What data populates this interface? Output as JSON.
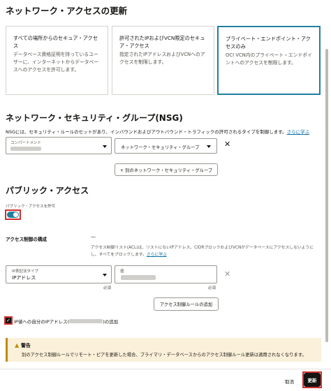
{
  "header": {
    "title": "ネットワーク・アクセスの更新"
  },
  "access_cards": [
    {
      "title": "すべての場所からのセキュア・アクセス",
      "desc": "データベース資格証明を持っているユーザーに、インターネットからデータベースへのアクセスを許可します。"
    },
    {
      "title": "許可されたIPおよびVCN限定のセキュア・アクセス",
      "desc": "指定されたIPアドレスおよびVCNへのアクセスを制限します。"
    },
    {
      "title": "プライベート・エンドポイント・アクセスのみ",
      "desc": "OCI VCN内のプライベート・エンドポイントへのアクセスを制限します。"
    }
  ],
  "nsg": {
    "heading": "ネットワーク・セキュリティ・グループ(NSG)",
    "desc": "NSGには、セキュリティ・ルールのセットがあり、インバウンドおよびアウトバウンド・トラフィックの許可されるタイプを制御します。",
    "learn_more": "さらに学ぶ",
    "compartment_label": "コンパートメント",
    "nsg_select_placeholder": "ネットワーク・セキュリティ・グループ",
    "add_nsg_button": "+ 別のネットワーク・セキュリティ・グループ"
  },
  "public_access": {
    "heading": "パブリック・アクセス",
    "toggle_label": "パブリック・アクセスを許可",
    "toggle_on": true,
    "acl_config_label": "アクセス制御の構成",
    "acl_dash": "—",
    "acl_desc": "アクセス制御リスト(ACL)は、リストにないIPアドレス、CIDRブロックおよびVCNがデータベースにアクセスしないようにし、すべてをブロックします。",
    "learn_more": "さらに学ぶ",
    "ip_type_label": "IP表記法タイプ",
    "ip_type_value": "IPアドレス",
    "value_label": "値",
    "required": "必須",
    "add_acl_button": "アクセス制御ルールの追加",
    "add_my_ip_label_prefix": "IP値への自分のIPアドレス(",
    "add_my_ip_label_suffix": ")の追加",
    "add_my_ip_checked": true
  },
  "warning": {
    "title": "警告",
    "text": "別のアクセス制御ルールでリモート・ピアを更新した場合、プライマリ・データベースからのアクセス制御ルール更新は適用されなくなります。"
  },
  "footer": {
    "cancel": "取消",
    "update": "更新"
  },
  "colors": {
    "accent": "#227e9e",
    "highlight": "#d32f2f",
    "primary_button": "#161513",
    "warning_bg": "#fbf0d9"
  }
}
